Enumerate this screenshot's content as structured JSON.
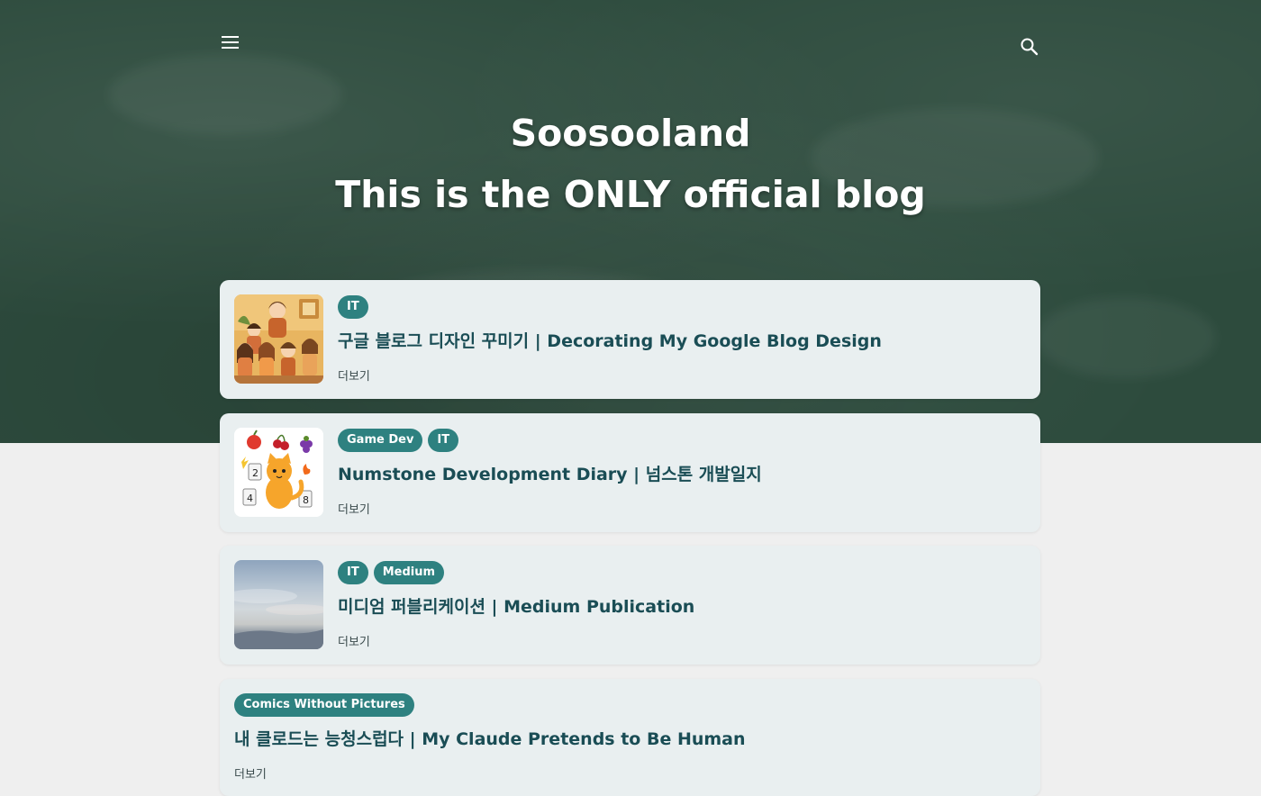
{
  "header": {
    "title_line1": "Soosooland",
    "title_line2": "This is the ONLY official blog",
    "menu_icon": "menu-icon",
    "search_icon": "search-icon",
    "background_color": "#2d4b3d"
  },
  "accent_color": "#2e8180",
  "posts": [
    {
      "labels": [
        "IT"
      ],
      "title": "구글 블로그 디자인 꾸미기 | Decorating My Google Blog Design",
      "more": "더보기",
      "thumbnail": "family-illustration"
    },
    {
      "labels": [
        "Game Dev",
        "IT"
      ],
      "title": "Numstone Development Diary | 넘스톤 개발일지",
      "more": "더보기",
      "thumbnail": "cat-illustration"
    },
    {
      "labels": [
        "IT",
        "Medium"
      ],
      "title": "미디엄 퍼블리케이션 | Medium Publication",
      "more": "더보기",
      "thumbnail": "sky-photo"
    },
    {
      "labels": [
        "Comics Without Pictures"
      ],
      "title": "내 클로드는 능청스럽다 | My Claude Pretends to Be Human",
      "more": "더보기"
    }
  ]
}
